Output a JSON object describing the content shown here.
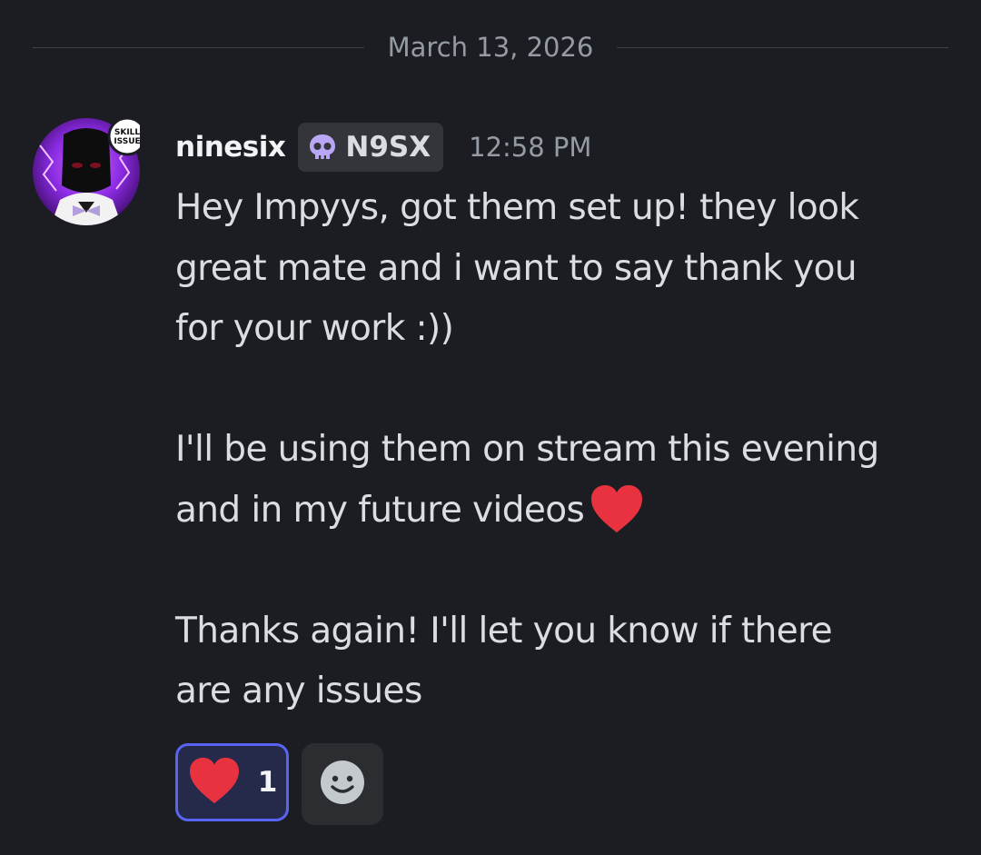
{
  "divider": {
    "date": "March 13, 2026"
  },
  "message": {
    "avatar_badge": "SKILL ISSUE",
    "username": "ninesix",
    "guild_tag": "N9SX",
    "timestamp": "12:58 PM",
    "paragraphs": [
      {
        "lines": [
          "Hey Impyys, got them set up! they look",
          "great mate and i want to say thank you",
          "for your work :))"
        ]
      },
      {
        "lines": [
          "I'll be using them on stream this evening",
          "and in my future videos"
        ]
      },
      {
        "lines": [
          "Thanks again! I'll let you know if there",
          "are any issues"
        ]
      }
    ]
  },
  "reactions": [
    {
      "emoji": "heart-icon",
      "count": "1",
      "reacted": true
    }
  ],
  "colors": {
    "background": "#1c1d22",
    "accent": "#5865f2",
    "heart": "#e8323f"
  }
}
